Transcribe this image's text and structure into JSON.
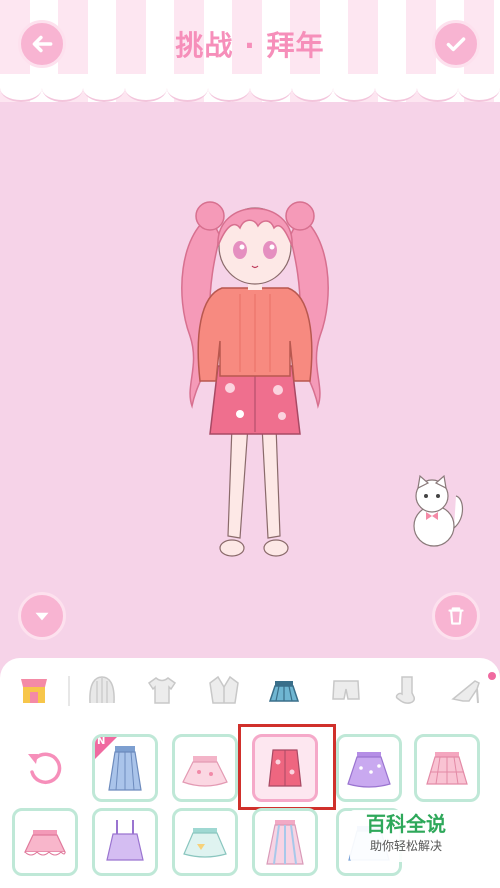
{
  "header": {
    "title": "挑战 · 拜年",
    "back_icon": "arrow-left-icon",
    "confirm_icon": "checkmark-icon"
  },
  "colors": {
    "background": "#f6d3e8",
    "accent_pink": "#f68fba",
    "button_pink": "#f8b4d2",
    "item_border": "#bfe8d7",
    "selection_red": "#d0302b"
  },
  "stage": {
    "collapse_icon": "chevron-down-icon",
    "delete_icon": "trash-icon"
  },
  "categories": [
    {
      "name": "shop",
      "icon": "shop-icon"
    },
    {
      "name": "hair",
      "icon": "hair-icon"
    },
    {
      "name": "top",
      "icon": "tshirt-icon"
    },
    {
      "name": "coat",
      "icon": "jacket-icon"
    },
    {
      "name": "skirt",
      "icon": "skirt-icon",
      "active": true
    },
    {
      "name": "pants",
      "icon": "shorts-icon"
    },
    {
      "name": "socks",
      "icon": "sock-icon"
    },
    {
      "name": "shoes",
      "icon": "heel-icon"
    }
  ],
  "items": {
    "new_badge": "N",
    "reset_icon": "reset-icon",
    "selected_index": 2
  },
  "watermark": {
    "title": "百科全说",
    "subtitle": "助你轻松解决"
  }
}
